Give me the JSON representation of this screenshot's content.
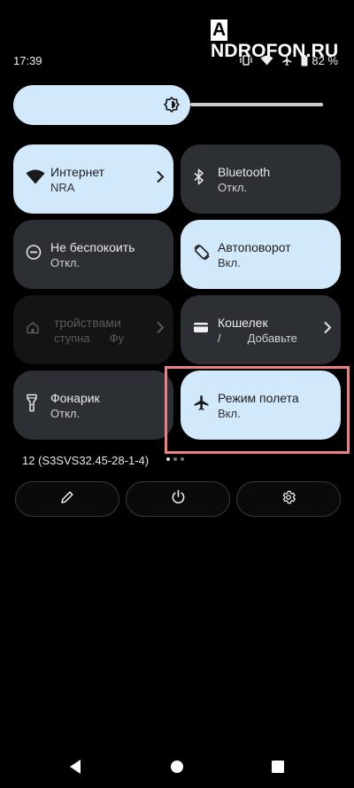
{
  "watermark": {
    "first_letter": "A",
    "rest": "NDROFON.RU"
  },
  "status_bar": {
    "time": "17:39",
    "battery": "82 %"
  },
  "tiles": {
    "internet": {
      "title": "Интернет",
      "subtitle": "NRA"
    },
    "bluetooth": {
      "title": "Bluetooth",
      "subtitle": "Откл."
    },
    "dnd": {
      "title": "Не беспокоить",
      "subtitle": "Откл."
    },
    "autorotate": {
      "title": "Автоповорот",
      "subtitle": "Вкл."
    },
    "devices": {
      "title": "тройствами",
      "subtitle": "ступна",
      "subtitle_extra": "Фу"
    },
    "wallet": {
      "title": "Кошелек",
      "subtitle": "/",
      "subtitle_extra": "Добавьте"
    },
    "flashlight": {
      "title": "Фонарик",
      "subtitle": "Откл."
    },
    "airplane": {
      "title": "Режим полета",
      "subtitle": "Вкл."
    }
  },
  "build_number": "12 (S3SVS32.45-28-1-4)",
  "colors": {
    "tile_on": "#d2e8fb",
    "tile_off": "#2c3034",
    "highlight": "#ea8186"
  }
}
